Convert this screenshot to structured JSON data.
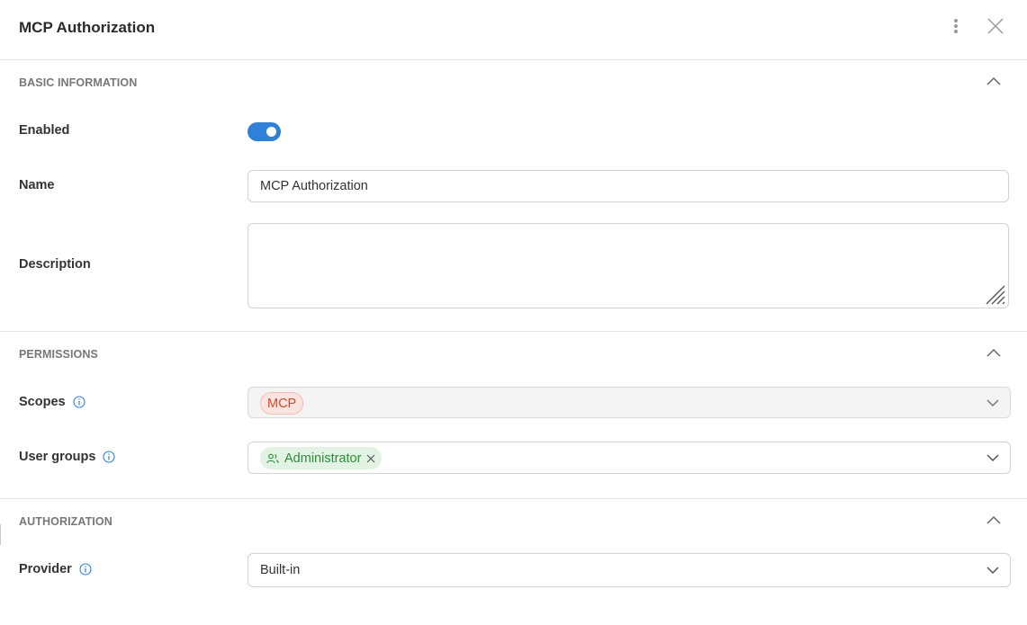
{
  "dialog": {
    "title": "MCP Authorization"
  },
  "sections": {
    "basic": {
      "title": "BASIC INFORMATION",
      "enabled_label": "Enabled",
      "enabled": true,
      "name_label": "Name",
      "name_value": "MCP Authorization",
      "description_label": "Description",
      "description_value": ""
    },
    "permissions": {
      "title": "PERMISSIONS",
      "scopes_label": "Scopes",
      "scopes": [
        "MCP"
      ],
      "user_groups_label": "User groups",
      "user_groups": [
        "Administrator"
      ]
    },
    "authorization": {
      "title": "AUTHORIZATION",
      "provider_label": "Provider",
      "provider_value": "Built-in"
    }
  },
  "colors": {
    "accent": "#2f80d8",
    "scope_chip_text": "#d04a2e",
    "group_chip_text": "#2e8c3a"
  },
  "icons": [
    "more-vertical-icon",
    "close-icon",
    "chevron-up-icon",
    "chevron-down-icon",
    "info-icon",
    "users-icon",
    "remove-icon",
    "resize-handle-icon"
  ]
}
